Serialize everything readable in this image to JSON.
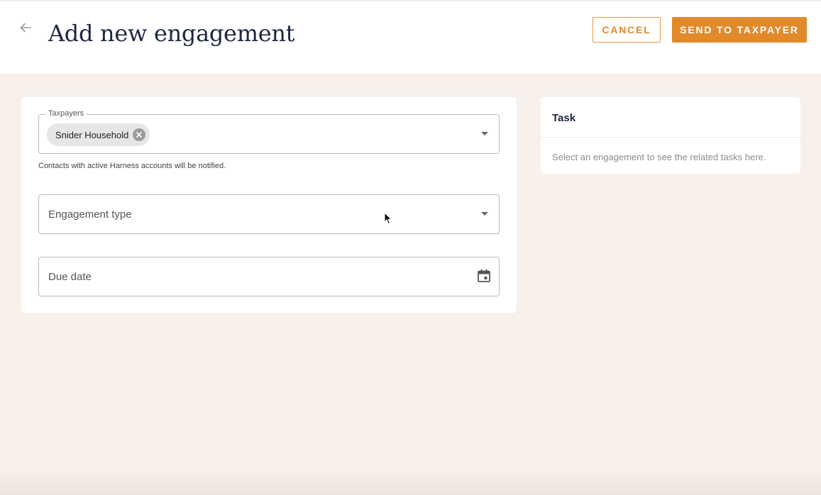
{
  "header": {
    "title": "Add new engagement",
    "back_icon": "arrow-left-icon",
    "cancel_label": "CANCEL",
    "send_label": "SEND TO TAXPAYER"
  },
  "form": {
    "taxpayers": {
      "legend": "Taxpayers",
      "chips": [
        {
          "label": "Snider Household"
        }
      ],
      "helper": "Contacts with active Harness accounts will be notified."
    },
    "engagement_type": {
      "placeholder": "Engagement type"
    },
    "due_date": {
      "placeholder": "Due date",
      "icon": "calendar-icon"
    }
  },
  "task_panel": {
    "title": "Task",
    "empty_message": "Select an engagement to see the related tasks here."
  },
  "colors": {
    "accent": "#e08a2c",
    "background": "#f8f0ea",
    "title": "#1c2742"
  }
}
